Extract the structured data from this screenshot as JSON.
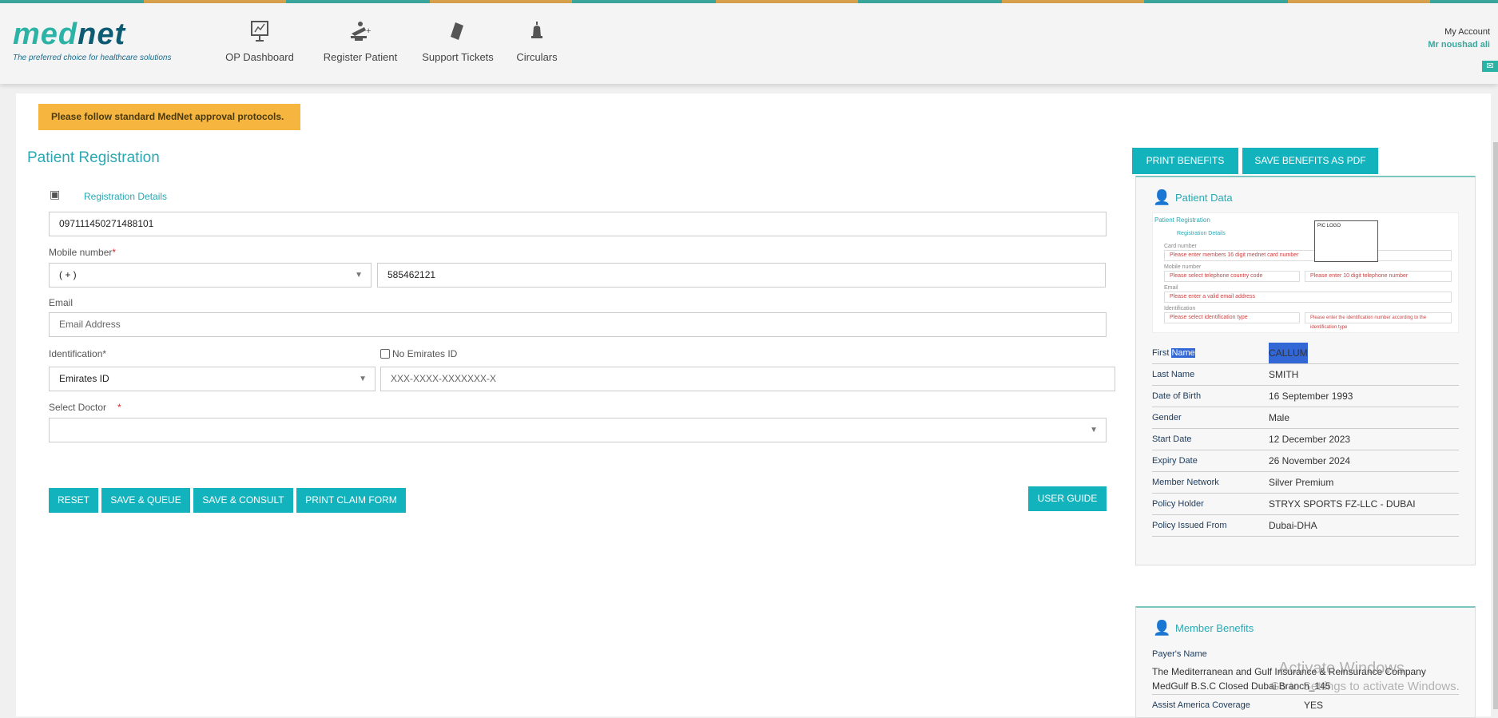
{
  "header": {
    "logo_part1": "med",
    "logo_part2": "net",
    "tagline": "The preferred choice for healthcare solutions",
    "nav": [
      {
        "label": "OP Dashboard",
        "icon": "dashboard-chart-icon"
      },
      {
        "label": "Register Patient",
        "icon": "register-patient-icon"
      },
      {
        "label": "Support Tickets",
        "icon": "ticket-icon"
      },
      {
        "label": "Circulars",
        "icon": "bell-icon"
      }
    ],
    "account_label": "My Account",
    "user_name": "Mr noushad ali"
  },
  "alert": "Please follow standard MedNet approval protocols.",
  "form": {
    "title": "Patient Registration",
    "section": "Registration Details",
    "card_number": "097111450271488101",
    "mobile_label": "Mobile number",
    "country_code": "( + )",
    "mobile_value": "585462121",
    "email_label": "Email",
    "email_placeholder": "Email Address",
    "identification_label": "Identification*",
    "no_emirates_id": "No Emirates ID",
    "id_type": "Emirates ID",
    "id_placeholder": "XXX-XXXX-XXXXXXX-X",
    "doctor_label": "Select Doctor",
    "doctor_value": "",
    "buttons": {
      "reset": "RESET",
      "save_queue": "SAVE & QUEUE",
      "save_consult": "SAVE & CONSULT",
      "print_claim": "PRINT CLAIM FORM",
      "user_guide": "USER GUIDE"
    }
  },
  "benefits_buttons": {
    "print": "PRINT BENEFITS",
    "save_pdf": "SAVE BENEFITS AS PDF"
  },
  "patient_data": {
    "title": "Patient Data",
    "guide": {
      "title": "Patient Registration",
      "section": "Registration Details",
      "card_label": "Card number",
      "card_hint": "Please enter members 16 digit mednet card number",
      "mobile_label": "Mobile number",
      "cc_hint": "Please select telephone country code",
      "phone_hint": "Please enter 10 digit telephone number",
      "email_label": "Email",
      "email_hint": "Please enter a valid email address",
      "id_label": "Identification",
      "id_type_hint": "Please select identification type",
      "id_hint": "Please enter the identification number according to the identification type",
      "card_logo": "PIC LOGO"
    },
    "first_name_label_a": "First ",
    "first_name_label_b": "Name",
    "first_name": "CALLUM",
    "rows": [
      {
        "label": "Last Name",
        "value": "SMITH"
      },
      {
        "label": "Date of Birth",
        "value": "16 September 1993"
      },
      {
        "label": "Gender",
        "value": "Male"
      },
      {
        "label": "Start Date",
        "value": "12 December 2023"
      },
      {
        "label": "Expiry Date",
        "value": "26 November 2024"
      },
      {
        "label": "Member Network",
        "value": "Silver Premium"
      },
      {
        "label": "Policy Holder",
        "value": "STRYX SPORTS FZ-LLC - DUBAI"
      },
      {
        "label": "Policy Issued From",
        "value": "Dubai-DHA"
      }
    ]
  },
  "member_benefits": {
    "title": "Member Benefits",
    "payer_label": "Payer's Name",
    "payer_line1": "The Mediterranean and Gulf Insurance & Reinsurance Company",
    "payer_line2": "MedGulf B.S.C Closed Dubai Branch_145",
    "assist_label": "Assist America Coverage",
    "assist_value": "YES"
  },
  "watermark": {
    "line1": "Activate Windows",
    "line2": "Go to Settings to activate Windows."
  }
}
